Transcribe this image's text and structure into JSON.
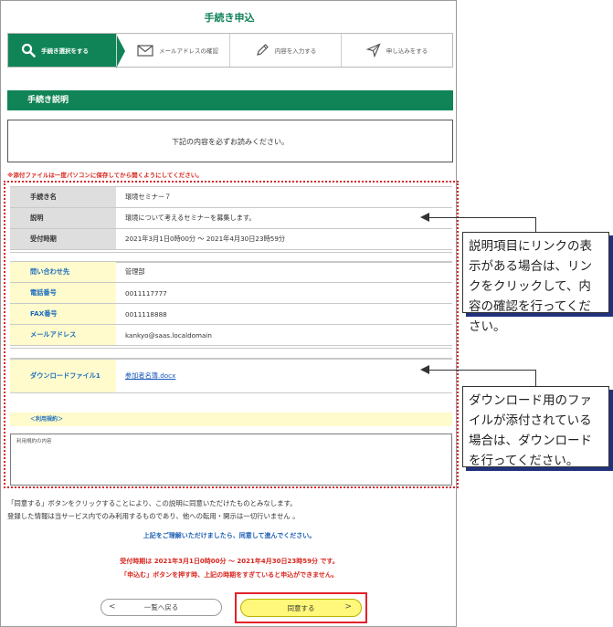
{
  "page": {
    "title": "手続き申込"
  },
  "steps": [
    {
      "label": "手続き選択をする",
      "icon": "search-icon",
      "active": true
    },
    {
      "label": "メールアドレスの確認",
      "icon": "mail-icon",
      "active": false
    },
    {
      "label": "内容を入力する",
      "icon": "pencil-icon",
      "active": false
    },
    {
      "label": "申し込みをする",
      "icon": "send-icon",
      "active": false
    }
  ],
  "section": {
    "title": "手続き説明"
  },
  "notice": {
    "text": "下記の内容を必ずお読みください。"
  },
  "warning": "※添付ファイルは一度パソコンに保存してから開くようにしてください。",
  "procedure": {
    "rows": [
      {
        "label": "手続き名",
        "value": "環境セミナー７"
      },
      {
        "label": "説明",
        "value": "環境について考えるセミナーを募集します。"
      },
      {
        "label": "受付時期",
        "value": "2021年3月1日0時00分 ～ 2021年4月30日23時59分"
      }
    ]
  },
  "contact": {
    "rows": [
      {
        "label": "問い合わせ先",
        "value": "管理部"
      },
      {
        "label": "電話番号",
        "value": "0011117777"
      },
      {
        "label": "FAX番号",
        "value": "0011118888"
      },
      {
        "label": "メールアドレス",
        "value": "kankyo@saas.localdomain"
      }
    ]
  },
  "download": {
    "label": "ダウンロードファイル1",
    "file": "参加者名簿.docx"
  },
  "terms": {
    "heading": "＜利用規約＞",
    "content": "利用規約の内容"
  },
  "agreement": {
    "line1": "「同意する」ボタンをクリックすることにより、この説明に同意いただけたものとみなします。",
    "line2": "登録した情報は当サービス内でのみ利用するものであり、他への転用・開示は一切行いません 。"
  },
  "info": {
    "blue": "上記をご理解いただけましたら、同意して進んでください。",
    "red1": "受付時期は 2021年3月1日0時00分 ～ 2021年4月30日23時59分 です。",
    "red2": "「申込む」ボタンを押す時、上記の時期をすぎていると申込ができません。"
  },
  "buttons": {
    "back": "一覧へ戻る",
    "agree": "同意する",
    "back_chevron": "<",
    "agree_chevron": ">"
  },
  "callouts": {
    "link": "説明項目にリンクの表示がある場合は、リンクをクリックして、内容の確認を行ってください。",
    "download": "ダウンロード用のファイルが添付されている場合は、ダウンロードを行ってください。"
  },
  "colors": {
    "accent": "#108457",
    "warning": "#d8251d",
    "link": "#1a56b8",
    "highlight": "#fff87a"
  }
}
